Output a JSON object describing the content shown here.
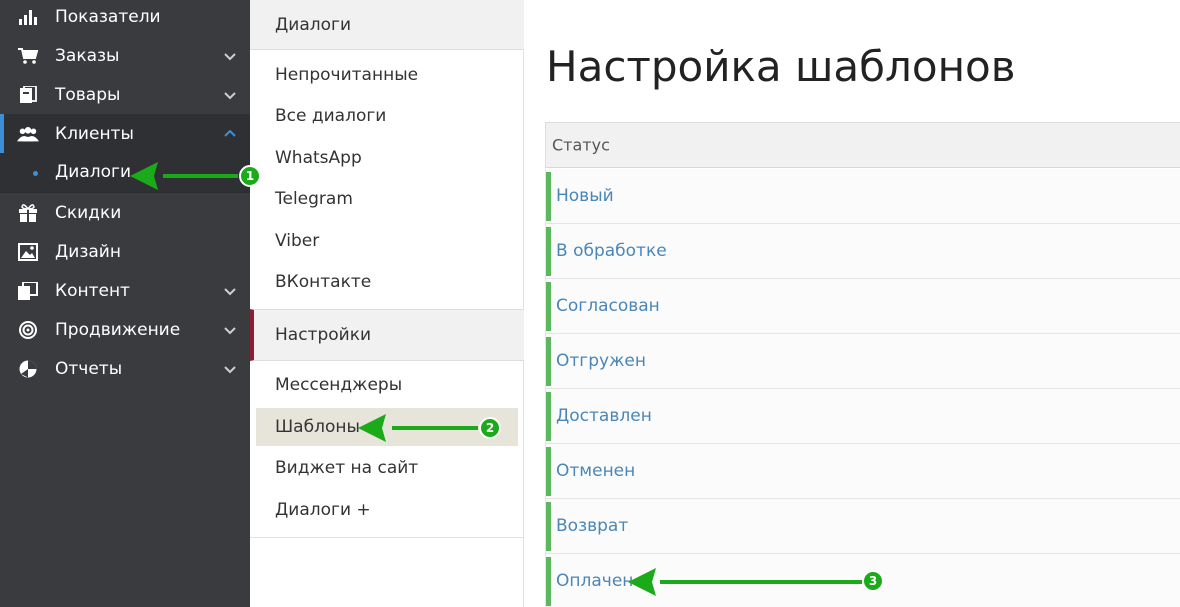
{
  "sidebar": {
    "items": [
      {
        "label": "Показатели",
        "icon": "bar-chart-icon"
      },
      {
        "label": "Заказы",
        "icon": "cart-icon"
      },
      {
        "label": "Товары",
        "icon": "box-icon"
      },
      {
        "label": "Клиенты",
        "icon": "users-icon"
      },
      {
        "label": "Скидки",
        "icon": "gift-icon"
      },
      {
        "label": "Дизайн",
        "icon": "image-icon"
      },
      {
        "label": "Контент",
        "icon": "pages-icon"
      },
      {
        "label": "Продвижение",
        "icon": "target-icon"
      },
      {
        "label": "Отчеты",
        "icon": "pie-chart-icon"
      }
    ],
    "sub_item": {
      "label": "Диалоги"
    }
  },
  "submenu": {
    "section1_title": "Диалоги",
    "section1_items": [
      "Непрочитанные",
      "Все диалоги",
      "WhatsApp",
      "Telegram",
      "Viber",
      "ВКонтакте"
    ],
    "section2_title": "Настройки",
    "section2_items": [
      "Мессенджеры",
      "Шаблоны",
      "Виджет на сайт",
      "Диалоги +"
    ]
  },
  "main": {
    "title": "Настройка шаблонов",
    "table_header": "Статус",
    "rows": [
      "Новый",
      "В обработке",
      "Согласован",
      "Отгружен",
      "Доставлен",
      "Отменен",
      "Возврат",
      "Оплачен"
    ]
  },
  "annotations": {
    "badge1": "1",
    "badge2": "2",
    "badge3": "3"
  },
  "colors": {
    "sidebar_bg": "#3a3b3f",
    "active_accent": "#3c8fd6",
    "status_bar": "#5cb85c",
    "link": "#4a86b8",
    "annotation": "#1aaa1a"
  }
}
